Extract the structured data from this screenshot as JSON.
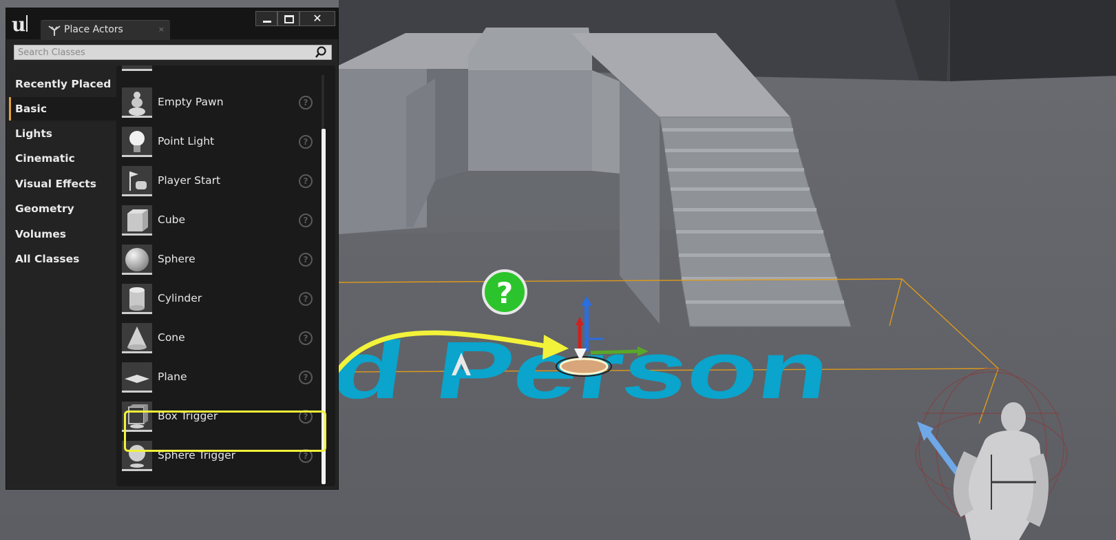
{
  "window": {
    "tab_label": "Place Actors",
    "search_placeholder": "Search Classes",
    "close_glyph": "✕"
  },
  "categories": [
    {
      "label": "Recently Placed",
      "active": false
    },
    {
      "label": "Basic",
      "active": true
    },
    {
      "label": "Lights",
      "active": false
    },
    {
      "label": "Cinematic",
      "active": false
    },
    {
      "label": "Visual Effects",
      "active": false
    },
    {
      "label": "Geometry",
      "active": false
    },
    {
      "label": "Volumes",
      "active": false
    },
    {
      "label": "All Classes",
      "active": false
    }
  ],
  "actors": [
    {
      "label": "Empty Pawn",
      "icon": "pawn-icon"
    },
    {
      "label": "Point Light",
      "icon": "light-bulb-icon"
    },
    {
      "label": "Player Start",
      "icon": "player-start-icon"
    },
    {
      "label": "Cube",
      "icon": "cube-icon"
    },
    {
      "label": "Sphere",
      "icon": "sphere-icon"
    },
    {
      "label": "Cylinder",
      "icon": "cylinder-icon"
    },
    {
      "label": "Cone",
      "icon": "cone-icon"
    },
    {
      "label": "Plane",
      "icon": "plane-icon"
    },
    {
      "label": "Box Trigger",
      "icon": "box-trigger-icon",
      "highlighted": true
    },
    {
      "label": "Sphere Trigger",
      "icon": "sphere-trigger-icon"
    }
  ],
  "viewport": {
    "floor_text": "d Person",
    "floor_text_color": "#0aa4cc",
    "trigger_box_color": "#e09a1a",
    "annotation_arrow_color": "#f2f23a"
  },
  "colors": {
    "accent": "#e2a03a",
    "panel_bg": "#242424",
    "highlight": "#f2f23a"
  }
}
